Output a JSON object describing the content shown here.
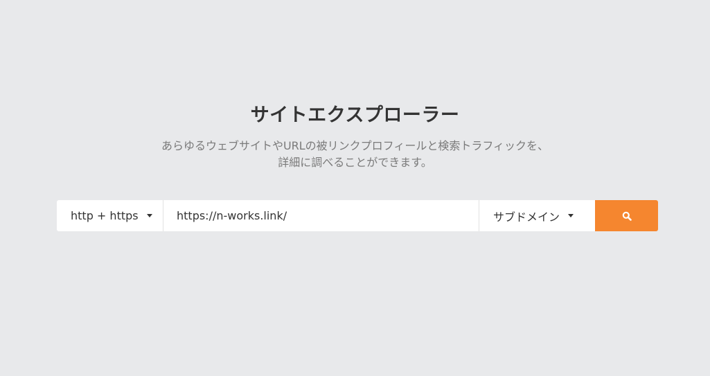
{
  "header": {
    "title": "サイトエクスプローラー",
    "subtitle_line1": "あらゆるウェブサイトやURLの被リンクプロフィールと検索トラフィックを、",
    "subtitle_line2": "詳細に調べることができます。"
  },
  "search": {
    "protocol_label": "http + https",
    "url_value": "https://n-works.link/",
    "mode_label": "サブドメイン",
    "button_icon": "search-icon"
  },
  "colors": {
    "background": "#e8e9eb",
    "accent": "#f5862f",
    "title_text": "#333333",
    "subtitle_text": "#7a7a7a"
  }
}
